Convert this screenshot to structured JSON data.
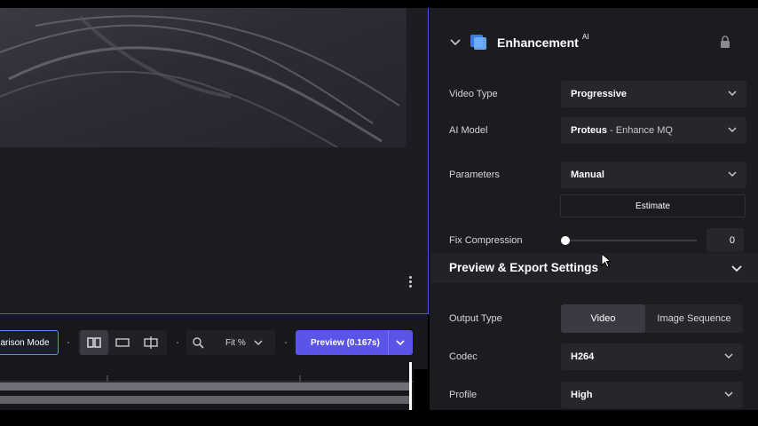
{
  "toolbar": {
    "comparison_label": "arison Mode",
    "zoom_label": "Fit %",
    "preview_label": "Preview (0.167s)"
  },
  "enhancement": {
    "title": "Enhancement",
    "title_badge": "AI",
    "video_type_label": "Video Type",
    "video_type_value": "Progressive",
    "ai_model_label": "AI Model",
    "ai_model_value": "Proteus",
    "ai_model_sub": " - Enhance MQ",
    "parameters_label": "Parameters",
    "parameters_value": "Manual",
    "estimate_label": "Estimate",
    "fix_compression_label": "Fix Compression",
    "fix_compression_value": "0"
  },
  "export": {
    "title": "Preview & Export Settings",
    "output_type_label": "Output Type",
    "output_options": [
      "Video",
      "Image Sequence"
    ],
    "codec_label": "Codec",
    "codec_value": "H264",
    "profile_label": "Profile",
    "profile_value": "High"
  },
  "colors": {
    "accent": "#5a55e8",
    "outline": "#5b8cff",
    "panel": "#1b1c20"
  }
}
